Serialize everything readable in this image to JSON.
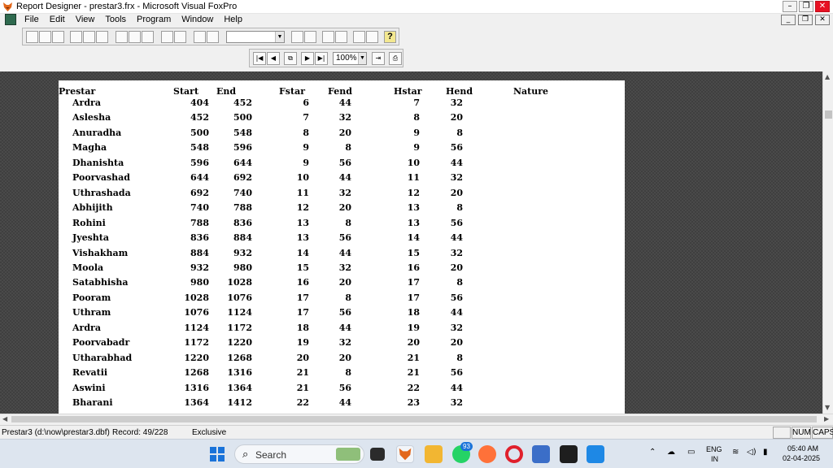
{
  "window": {
    "title": "Report Designer - prestar3.frx - Microsoft Visual FoxPro"
  },
  "menu": [
    "File",
    "Edit",
    "View",
    "Tools",
    "Program",
    "Window",
    "Help"
  ],
  "preview_toolbar": {
    "zoom": "100%"
  },
  "report": {
    "headers": {
      "prestar": "Prestar",
      "start": "Start",
      "end": "End",
      "fstar": "Fstar",
      "fend": "Fend",
      "hstar": "Hstar",
      "hend": "Hend",
      "nature": "Nature"
    },
    "rows": [
      {
        "name": "Ardra",
        "start": "404",
        "end": "452",
        "fstar": "6",
        "fend": "44",
        "hstar": "7",
        "hend": "32"
      },
      {
        "name": "Aslesha",
        "start": "452",
        "end": "500",
        "fstar": "7",
        "fend": "32",
        "hstar": "8",
        "hend": "20"
      },
      {
        "name": "Anuradha",
        "start": "500",
        "end": "548",
        "fstar": "8",
        "fend": "20",
        "hstar": "9",
        "hend": "8"
      },
      {
        "name": "Magha",
        "start": "548",
        "end": "596",
        "fstar": "9",
        "fend": "8",
        "hstar": "9",
        "hend": "56"
      },
      {
        "name": "Dhanishta",
        "start": "596",
        "end": "644",
        "fstar": "9",
        "fend": "56",
        "hstar": "10",
        "hend": "44"
      },
      {
        "name": "Poorvashad",
        "start": "644",
        "end": "692",
        "fstar": "10",
        "fend": "44",
        "hstar": "11",
        "hend": "32"
      },
      {
        "name": "Uthrashada",
        "start": "692",
        "end": "740",
        "fstar": "11",
        "fend": "32",
        "hstar": "12",
        "hend": "20"
      },
      {
        "name": "Abhijith",
        "start": "740",
        "end": "788",
        "fstar": "12",
        "fend": "20",
        "hstar": "13",
        "hend": "8"
      },
      {
        "name": "Rohini",
        "start": "788",
        "end": "836",
        "fstar": "13",
        "fend": "8",
        "hstar": "13",
        "hend": "56"
      },
      {
        "name": "Jyeshta",
        "start": "836",
        "end": "884",
        "fstar": "13",
        "fend": "56",
        "hstar": "14",
        "hend": "44"
      },
      {
        "name": "Vishakham",
        "start": "884",
        "end": "932",
        "fstar": "14",
        "fend": "44",
        "hstar": "15",
        "hend": "32"
      },
      {
        "name": "Moola",
        "start": "932",
        "end": "980",
        "fstar": "15",
        "fend": "32",
        "hstar": "16",
        "hend": "20"
      },
      {
        "name": "Satabhisha",
        "start": "980",
        "end": "1028",
        "fstar": "16",
        "fend": "20",
        "hstar": "17",
        "hend": "8"
      },
      {
        "name": "Pooram",
        "start": "1028",
        "end": "1076",
        "fstar": "17",
        "fend": "8",
        "hstar": "17",
        "hend": "56"
      },
      {
        "name": "Uthram",
        "start": "1076",
        "end": "1124",
        "fstar": "17",
        "fend": "56",
        "hstar": "18",
        "hend": "44"
      },
      {
        "name": "Ardra",
        "start": "1124",
        "end": "1172",
        "fstar": "18",
        "fend": "44",
        "hstar": "19",
        "hend": "32"
      },
      {
        "name": "Poorvabadr",
        "start": "1172",
        "end": "1220",
        "fstar": "19",
        "fend": "32",
        "hstar": "20",
        "hend": "20"
      },
      {
        "name": "Utharabhad",
        "start": "1220",
        "end": "1268",
        "fstar": "20",
        "fend": "20",
        "hstar": "21",
        "hend": "8"
      },
      {
        "name": "Revatii",
        "start": "1268",
        "end": "1316",
        "fstar": "21",
        "fend": "8",
        "hstar": "21",
        "hend": "56"
      },
      {
        "name": "Aswini",
        "start": "1316",
        "end": "1364",
        "fstar": "21",
        "fend": "56",
        "hstar": "22",
        "hend": "44"
      },
      {
        "name": "Bharani",
        "start": "1364",
        "end": "1412",
        "fstar": "22",
        "fend": "44",
        "hstar": "23",
        "hend": "32"
      }
    ]
  },
  "status": {
    "table": "Prestar3 (d:\\now\\prestar3.dbf)",
    "record": "Record: 49/228",
    "mode": "Exclusive",
    "num": "NUM",
    "caps": "CAPS"
  },
  "taskbar": {
    "search_placeholder": "Search",
    "whatsapp_badge": "93",
    "lang": "ENG",
    "region": "IN",
    "time": "05:40 AM",
    "date": "02-04-2025"
  }
}
